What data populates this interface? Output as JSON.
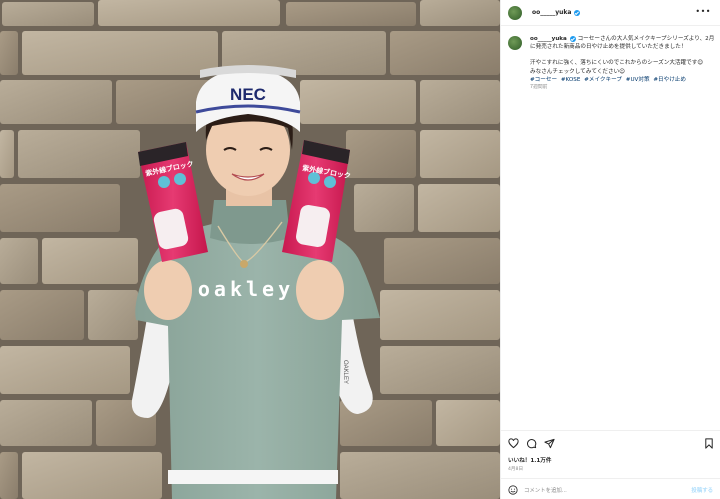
{
  "post": {
    "username": "oo_____yuka",
    "caption_user": "oo_____yuka",
    "caption_line1": " コーセーさんの大人気メイクキープシリーズより、2月に発売された新商品の日やけ止めを提供していただきました！",
    "caption_line2": "汗やこすれに強く、落ちにくいのでこれからのシーズン大活躍です😊",
    "caption_line3": "みなさんチェックしてみてください😉",
    "hashtags": [
      "#コーセー",
      "#KOSE",
      "#メイクキープ",
      "#UV対策",
      "#日やけ止め"
    ],
    "caption_time": "7週間前",
    "likes": "いいね！1.1万件",
    "date": "4月8日",
    "comment_placeholder": "コメントを追加...",
    "post_button": "投稿する"
  },
  "photo": {
    "visor_text": "NEC",
    "shirt_text": "oakley",
    "sleeve_text": "OAKLEY",
    "product_label": "紫外線ブロック"
  },
  "icons": [
    "more-icon",
    "heart-icon",
    "comment-icon",
    "share-icon",
    "bookmark-icon",
    "emoji-icon",
    "verified-badge-icon"
  ],
  "colors": {
    "link": "#00376b",
    "verified": "#1d9bf0",
    "muted": "#8e8e8e",
    "product_pink": "#d81e5b",
    "shirt": "#93aca2"
  }
}
